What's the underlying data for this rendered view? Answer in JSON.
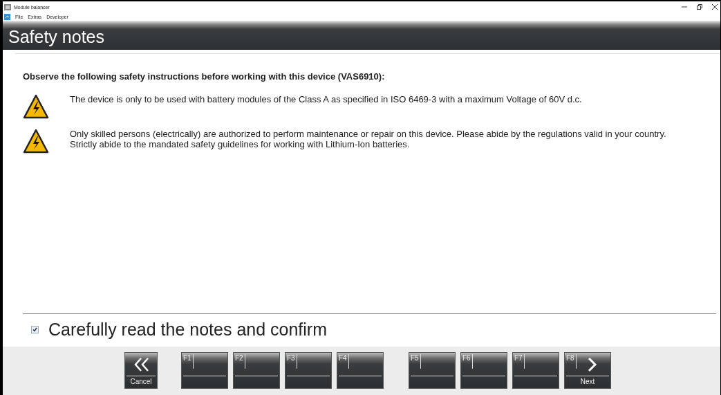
{
  "window": {
    "title": "Module balancer"
  },
  "menu": [
    "File",
    "Extras",
    "Developer"
  ],
  "header": {
    "title": "Safety notes"
  },
  "intro": "Observe the following safety instructions before working with this device (VAS6910):",
  "notes": [
    {
      "paragraphs": [
        "The device is only to be used with battery modules of the Class A as specified in ISO 6469-3 with a maximum Voltage of 60V d.c."
      ]
    },
    {
      "paragraphs": [
        "Only skilled persons (electrically) are authorized to perform maintenance or repair on this device. Please abide by the regulations valid in your country.",
        "Strictly abide to the mandated safety guidelines for working with Lithium-Ion batteries."
      ]
    }
  ],
  "confirm": {
    "label": "Carefully read the notes and confirm",
    "checked": true
  },
  "buttons": [
    {
      "kind": "cancel",
      "label": "Cancel"
    },
    {
      "kind": "function",
      "key": "F1"
    },
    {
      "kind": "function",
      "key": "F2"
    },
    {
      "kind": "function",
      "key": "F3"
    },
    {
      "kind": "function",
      "key": "F4"
    },
    {
      "kind": "function",
      "key": "F5"
    },
    {
      "kind": "function",
      "key": "F6"
    },
    {
      "kind": "function",
      "key": "F7"
    },
    {
      "kind": "next",
      "key": "F8",
      "label": "Next"
    }
  ]
}
